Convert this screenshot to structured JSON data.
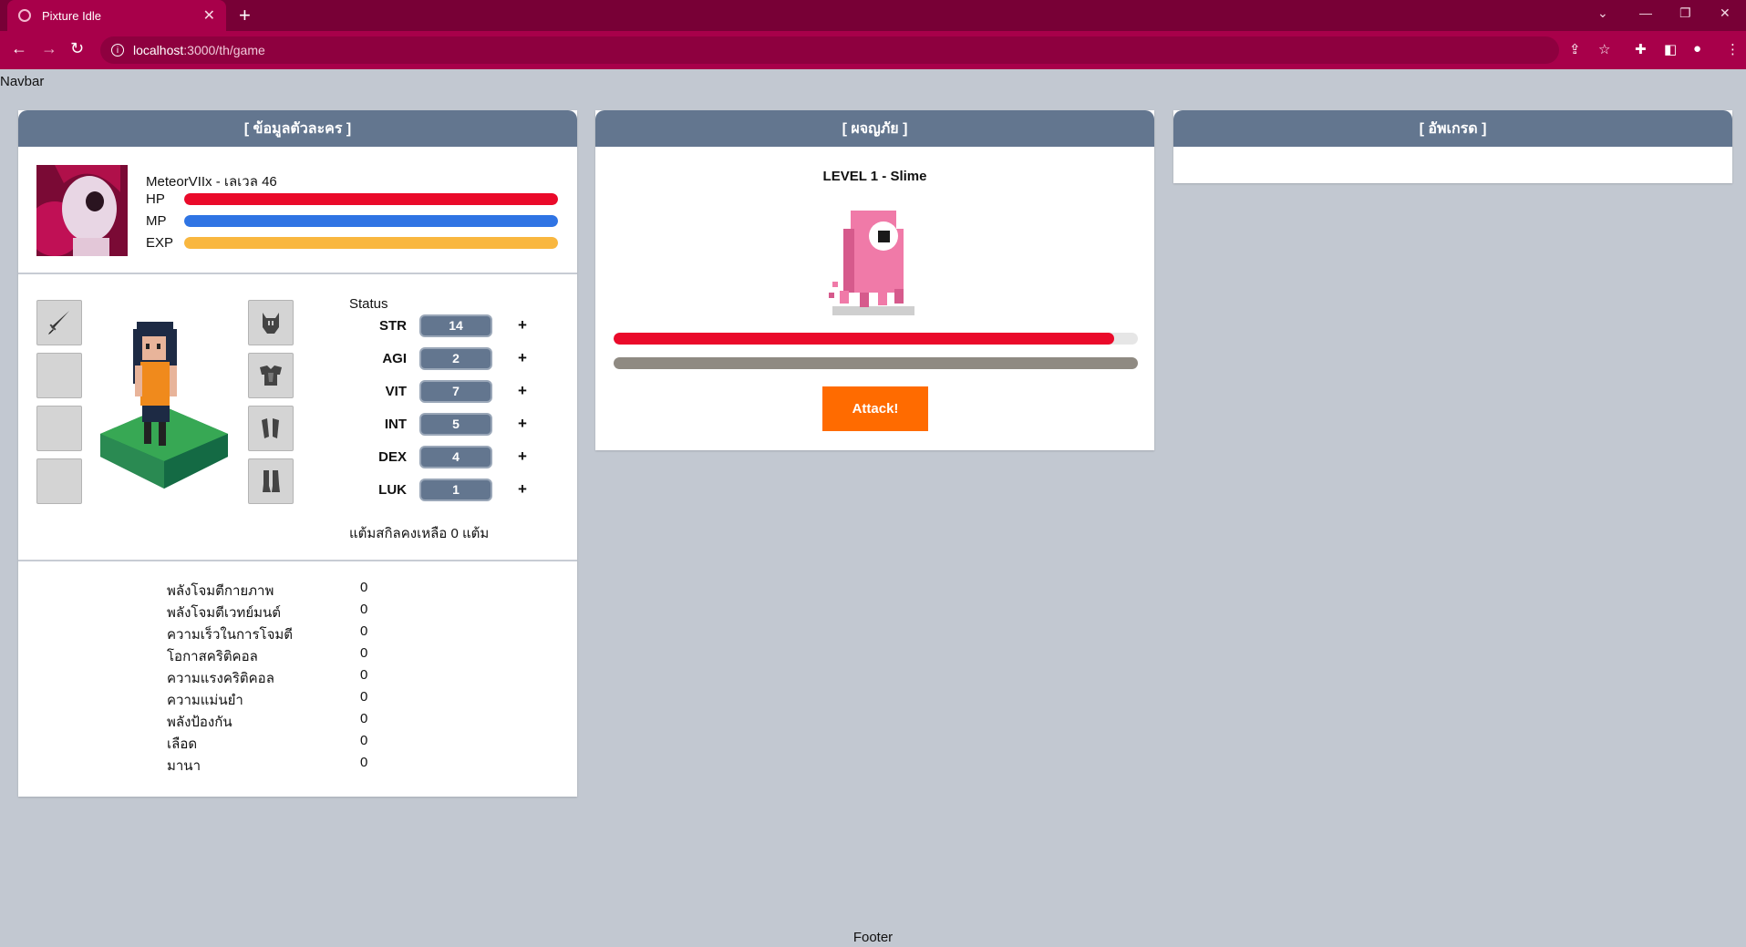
{
  "browser": {
    "tab_title": "Pixture Idle",
    "url_host": "localhost",
    "url_path": ":3000/th/game"
  },
  "navbar": {
    "text": "Navbar"
  },
  "footer": {
    "text": "Footer"
  },
  "character_panel": {
    "header": "[ ข้อมูลตัวละคร ]",
    "name_level": "MeteorVIIx - เลเวล 46",
    "bars": [
      {
        "label": "HP",
        "fill": 1.0,
        "color": "#ea0a2a"
      },
      {
        "label": "MP",
        "fill": 1.0,
        "color": "#2f74e4"
      },
      {
        "label": "EXP",
        "fill": 1.0,
        "color": "#f9b73f"
      }
    ],
    "equipment_left": [
      "sword-icon",
      "",
      "",
      ""
    ],
    "equipment_right": [
      "helmet-icon",
      "armor-icon",
      "gloves-icon",
      "boots-icon"
    ],
    "status_title": "Status",
    "stats": [
      {
        "name": "STR",
        "value": "14"
      },
      {
        "name": "AGI",
        "value": "2"
      },
      {
        "name": "VIT",
        "value": "7"
      },
      {
        "name": "INT",
        "value": "5"
      },
      {
        "name": "DEX",
        "value": "4"
      },
      {
        "name": "LUK",
        "value": "1"
      }
    ],
    "plus_label": "+",
    "remaining_points": "แต้มสกิลคงเหลือ 0 แต้ม",
    "attributes": [
      {
        "name": "พลังโจมตีกายภาพ",
        "value": "0"
      },
      {
        "name": "พลังโจมตีเวทย์มนต์",
        "value": "0"
      },
      {
        "name": "ความเร็วในการโจมตี",
        "value": "0"
      },
      {
        "name": "โอกาสคริติคอล",
        "value": "0"
      },
      {
        "name": "ความแรงคริติคอล",
        "value": "0"
      },
      {
        "name": "ความแม่นยำ",
        "value": "0"
      },
      {
        "name": "พลังป้องกัน",
        "value": "0"
      },
      {
        "name": "เลือด",
        "value": "0"
      },
      {
        "name": "มานา",
        "value": "0"
      }
    ]
  },
  "enemy_panel": {
    "header": "[ ผจญภัย ]",
    "title": "LEVEL 1 - Slime",
    "hp_fill": 0.955,
    "hp_color": "#ea0a2a",
    "attack_label": "Attack!"
  },
  "upgrade_panel": {
    "header": "[ อัพเกรด ]"
  }
}
